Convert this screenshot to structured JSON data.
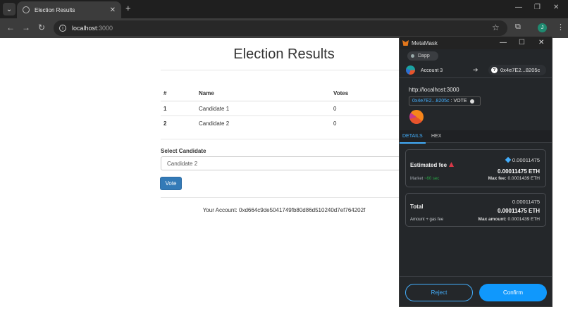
{
  "browser": {
    "tab_title": "Election Results",
    "url_host": "localhost",
    "url_port": ":3000",
    "avatar_letter": "J"
  },
  "page": {
    "title": "Election Results",
    "table": {
      "headers": [
        "#",
        "Name",
        "Votes"
      ],
      "rows": [
        {
          "id": "1",
          "name": "Candidate 1",
          "votes": "0"
        },
        {
          "id": "2",
          "name": "Candidate 2",
          "votes": "0"
        }
      ]
    },
    "select_label": "Select Candidate",
    "select_value": "Candidate 2",
    "vote_button": "Vote",
    "account_text": "Your Account: 0xd664c9de5041749fb80d86d510240d7ef764202f"
  },
  "metamask": {
    "window_title": "MetaMask",
    "dapp_label": "Dapp",
    "account_name": "Account 3",
    "to_address": "0x4e7E2...8205c",
    "origin": "http://localhost:3000",
    "method_address": "0x4e7E2...8205c",
    "method_sep": ":",
    "method_name": "VOTE",
    "tabs": {
      "details": "DETAILS",
      "hex": "HEX"
    },
    "fee": {
      "label": "Estimated fee",
      "top": "0.00011475",
      "eth": "0.00011475 ETH",
      "market_label": "Market",
      "market_time": "~60 sec",
      "max_label": "Max fee:",
      "max_value": "0.0001439 ETH"
    },
    "total": {
      "label": "Total",
      "top": "0.00011475",
      "eth": "0.00011475 ETH",
      "sub_label": "Amount + gas fee",
      "max_label": "Max amount:",
      "max_value": "0.0001439 ETH"
    },
    "reject": "Reject",
    "confirm": "Confirm"
  }
}
